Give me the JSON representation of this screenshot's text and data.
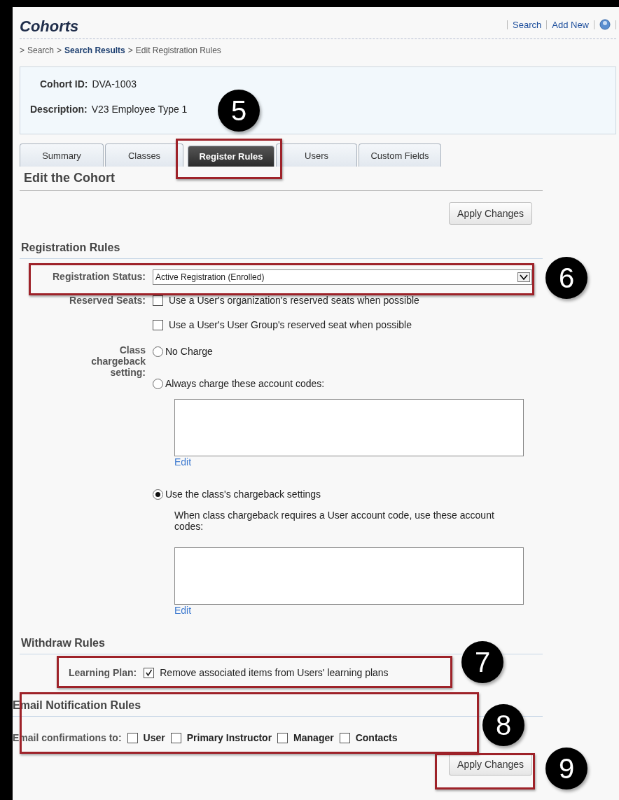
{
  "header": {
    "title": "Cohorts",
    "links": [
      {
        "label": "Search"
      },
      {
        "label": "Add New"
      }
    ]
  },
  "breadcrumb": [
    {
      "separator": ">",
      "label": "Search",
      "kind": "plain"
    },
    {
      "separator": ">",
      "label": "Search Results",
      "kind": "link"
    },
    {
      "separator": ">",
      "label": "Edit Registration Rules",
      "kind": "plain"
    }
  ],
  "summary": [
    {
      "label": "Cohort ID:",
      "value": "DVA-1003"
    },
    {
      "label": "Description:",
      "value": "V23 Employee Type 1"
    }
  ],
  "tabs": [
    {
      "label": "Summary",
      "selected": false
    },
    {
      "label": "Classes",
      "selected": false
    },
    {
      "label": "Register Rules",
      "selected": true
    },
    {
      "label": "Users",
      "selected": false
    },
    {
      "label": "Custom Fields",
      "selected": false
    }
  ],
  "section_title": "Edit the Cohort",
  "top_button": "Apply Changes",
  "registration_rules": {
    "heading": "Registration Rules",
    "status": {
      "label": "Registration Status:",
      "value": "Active Registration (Enrolled)"
    },
    "reserved_seats": {
      "label": "Reserved Seats:",
      "options": [
        {
          "label": "Use a User's organization's reserved seats when possible",
          "checked": false
        },
        {
          "label": "Use a User's User Group's reserved seat when possible",
          "checked": false
        }
      ]
    },
    "chargeback": {
      "label": "Class chargeback setting:",
      "options": [
        {
          "label": "No Charge",
          "selected": false
        },
        {
          "label": "Always charge these account codes:",
          "selected": false,
          "edit_link": "Edit"
        },
        {
          "label": "Use the class's chargeback settings",
          "selected": true,
          "note": "When class chargeback requires a User account code, use these account codes:",
          "edit_link": "Edit"
        }
      ]
    }
  },
  "withdraw_rules": {
    "heading": "Withdraw Rules",
    "learning_plan": {
      "label": "Learning Plan:",
      "option": {
        "label": "Remove associated items from Users' learning plans",
        "checked": true
      }
    }
  },
  "email_rules": {
    "heading": "Email Notification Rules",
    "confirmations": {
      "label": "Email confirmations to:",
      "options": [
        {
          "label": "User",
          "checked": false
        },
        {
          "label": "Primary Instructor",
          "checked": false
        },
        {
          "label": "Manager",
          "checked": false
        },
        {
          "label": "Contacts",
          "checked": false
        }
      ]
    }
  },
  "bottom_button": "Apply Changes",
  "callouts": [
    "5",
    "6",
    "7",
    "8",
    "9"
  ]
}
